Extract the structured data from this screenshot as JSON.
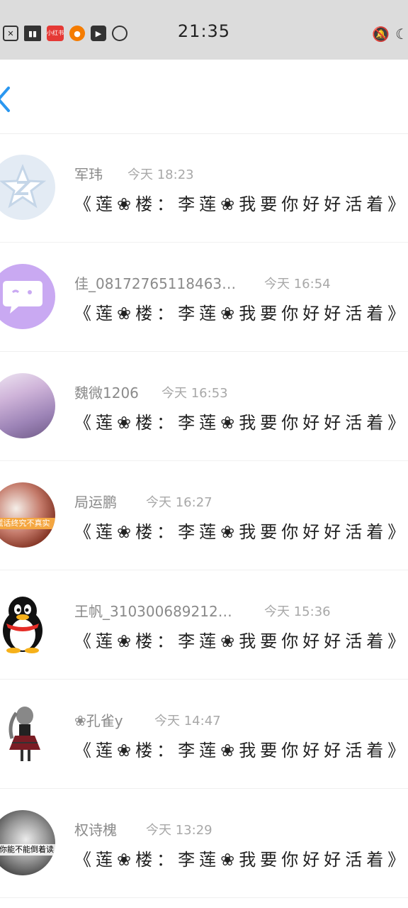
{
  "status_bar": {
    "time": "21:35",
    "left_icons": [
      "close-box-icon",
      "book-icon",
      "xiaohongshu-icon",
      "taobao-icon",
      "play-icon",
      "capsule-icon"
    ],
    "right_icons": [
      "mute-bell-icon",
      "moon-icon"
    ],
    "red_icon_text": "小红书"
  },
  "nav": {
    "back_icon": "chevron-left-icon",
    "accent": "#2a97f0"
  },
  "messages": [
    {
      "name": "军玮",
      "time": "今天 18:23",
      "text": "《莲❀楼：李莲❀我要你好好活着》",
      "avatar": "qzone-star"
    },
    {
      "name": "佳_081727651184​63…",
      "time": "今天 16:54",
      "text": "《莲❀楼：李莲❀我要你好好活着》",
      "avatar": "chat-bubble"
    },
    {
      "name": "魏微1206",
      "time": "今天 16:53",
      "text": "《莲❀楼：李莲❀我要你好好活着》",
      "avatar": "sky-photo"
    },
    {
      "name": "局运鹏",
      "time": "今天 16:27",
      "text": "《莲❀楼：李莲❀我要你好好活着》",
      "avatar": "girl-photo",
      "avatar_text": "谎话终究不真实"
    },
    {
      "name": "王帆_310300689212…",
      "time": "今天 15:36",
      "text": "《莲❀楼：李莲❀我要你好好活着》",
      "avatar": "qq-penguin"
    },
    {
      "name": "❀孔雀y",
      "time": "今天 14:47",
      "text": "《莲❀楼：李莲❀我要你好好活着》",
      "avatar": "anime-girl"
    },
    {
      "name": "权诗槐",
      "time": "今天 13:29",
      "text": "《莲❀楼：李莲❀我要你好好活着》",
      "avatar": "bw-photo",
      "avatar_text": "爱你能不能倒着读"
    }
  ]
}
